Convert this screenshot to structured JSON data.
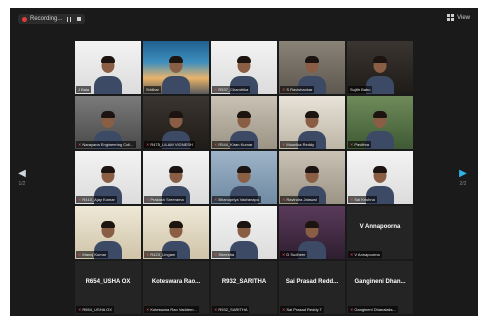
{
  "topbar": {
    "recording_label": "Recording...",
    "view_label": "View"
  },
  "nav": {
    "page_left": "1/2",
    "page_right": "2/2"
  },
  "participants": [
    {
      "name": "J Bala",
      "scene": "s-white",
      "video": true,
      "muted": false
    },
    {
      "name": "Sridhar",
      "scene": "s-sky",
      "video": true,
      "muted": false,
      "active": true
    },
    {
      "name": "R537_Chandrika",
      "scene": "s-white",
      "video": true,
      "muted": true
    },
    {
      "name": "S Ravishankar",
      "scene": "s-room",
      "video": true,
      "muted": true
    },
    {
      "name": "Sujith Babu",
      "scene": "s-dark",
      "video": true,
      "muted": false
    },
    {
      "name": "Narayana Engineering Coll...",
      "scene": "s-grey",
      "video": true,
      "muted": true
    },
    {
      "name": "R475_LILAM VIGNESH",
      "scene": "s-dark",
      "video": true,
      "muted": true
    },
    {
      "name": "R544_Kiran Kumar",
      "scene": "s-wall",
      "video": true,
      "muted": true
    },
    {
      "name": "Mounika Reddy",
      "scene": "s-light",
      "video": true,
      "muted": true
    },
    {
      "name": "Pavithra",
      "scene": "s-green",
      "video": true,
      "muted": true
    },
    {
      "name": "R410_Ajay Kumar",
      "scene": "s-white",
      "video": true,
      "muted": true
    },
    {
      "name": "Prakash Sreerama",
      "scene": "s-white",
      "video": true,
      "muted": true
    },
    {
      "name": "Bhanupriya Vadranapu",
      "scene": "s-blue",
      "video": true,
      "muted": true
    },
    {
      "name": "Ravindra Jaiswal",
      "scene": "s-wall",
      "video": true,
      "muted": true
    },
    {
      "name": "Sai Krishna",
      "scene": "s-white",
      "video": true,
      "muted": true
    },
    {
      "name": "Manoj Kumar",
      "scene": "s-cream",
      "video": true,
      "muted": true
    },
    {
      "name": "R423_Lingam",
      "scene": "s-cream",
      "video": true,
      "muted": true
    },
    {
      "name": "Sireesha",
      "scene": "s-white",
      "video": true,
      "muted": true
    },
    {
      "name": "D Sudheer",
      "scene": "s-purple",
      "video": true,
      "muted": true
    },
    {
      "name": "V Annapoorna",
      "scene": "",
      "video": false,
      "muted": true,
      "big": "V Annapoorna"
    },
    {
      "name": "R654_USHA OX",
      "scene": "",
      "video": false,
      "muted": true,
      "big": "R654_USHA OX"
    },
    {
      "name": "Koteswara Rao Vaddem...",
      "scene": "",
      "video": false,
      "muted": true,
      "big": "Koteswara Rao..."
    },
    {
      "name": "R932_SARITHA",
      "scene": "",
      "video": false,
      "muted": true,
      "big": "R932_SARITHA"
    },
    {
      "name": "Sai Prasad Reddy T",
      "scene": "",
      "video": false,
      "muted": true,
      "big": "Sai Prasad Redd..."
    },
    {
      "name": "Gangineni Dhanalaks...",
      "scene": "",
      "video": false,
      "muted": true,
      "big": "Gangineni Dhan..."
    }
  ]
}
